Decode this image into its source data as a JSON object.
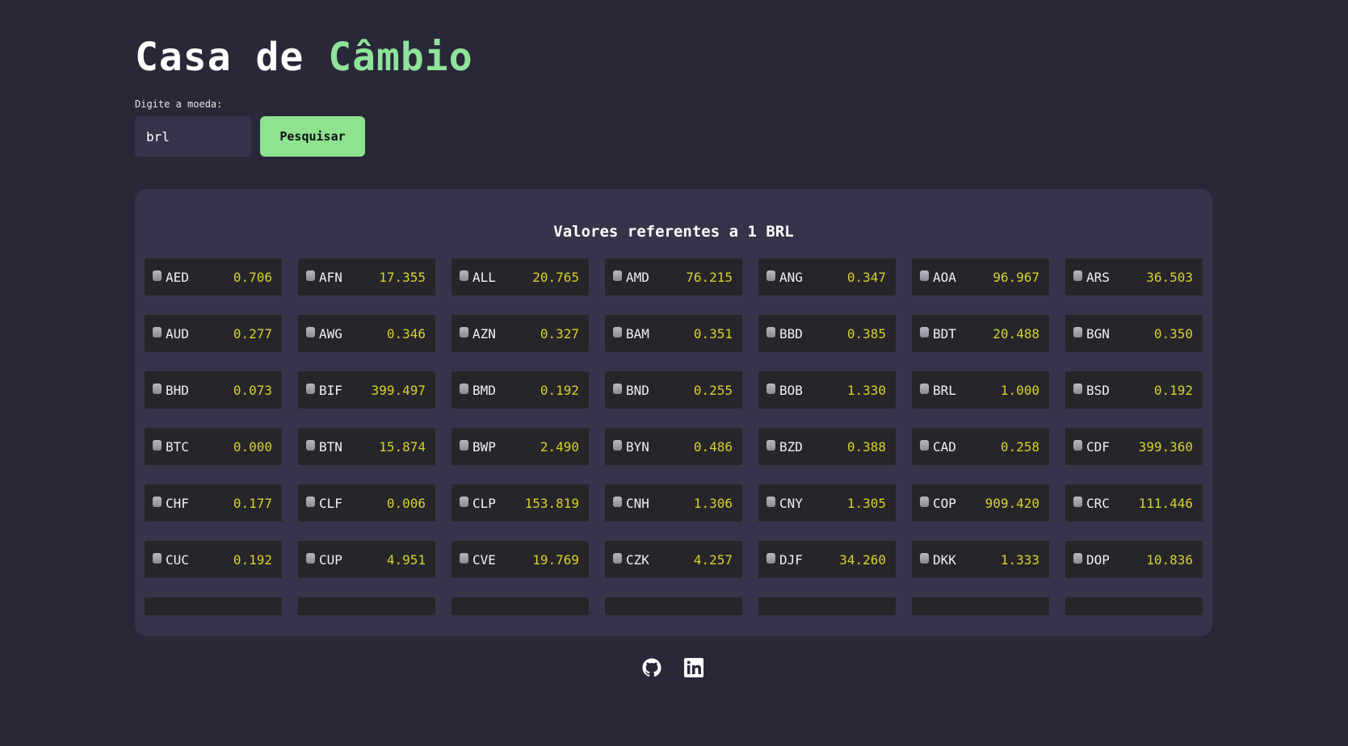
{
  "header": {
    "title_part1": "Casa de",
    "title_part2": "Câmbio"
  },
  "search": {
    "label": "Digite a moeda:",
    "value": "brl",
    "button_label": "Pesquisar"
  },
  "rates": {
    "title": "Valores referentes a 1 BRL",
    "icon": "coin-icon",
    "items": [
      {
        "code": "AED",
        "value": "0.706"
      },
      {
        "code": "AFN",
        "value": "17.355"
      },
      {
        "code": "ALL",
        "value": "20.765"
      },
      {
        "code": "AMD",
        "value": "76.215"
      },
      {
        "code": "ANG",
        "value": "0.347"
      },
      {
        "code": "AOA",
        "value": "96.967"
      },
      {
        "code": "ARS",
        "value": "36.503"
      },
      {
        "code": "AUD",
        "value": "0.277"
      },
      {
        "code": "AWG",
        "value": "0.346"
      },
      {
        "code": "AZN",
        "value": "0.327"
      },
      {
        "code": "BAM",
        "value": "0.351"
      },
      {
        "code": "BBD",
        "value": "0.385"
      },
      {
        "code": "BDT",
        "value": "20.488"
      },
      {
        "code": "BGN",
        "value": "0.350"
      },
      {
        "code": "BHD",
        "value": "0.073"
      },
      {
        "code": "BIF",
        "value": "399.497"
      },
      {
        "code": "BMD",
        "value": "0.192"
      },
      {
        "code": "BND",
        "value": "0.255"
      },
      {
        "code": "BOB",
        "value": "1.330"
      },
      {
        "code": "BRL",
        "value": "1.000"
      },
      {
        "code": "BSD",
        "value": "0.192"
      },
      {
        "code": "BTC",
        "value": "0.000"
      },
      {
        "code": "BTN",
        "value": "15.874"
      },
      {
        "code": "BWP",
        "value": "2.490"
      },
      {
        "code": "BYN",
        "value": "0.486"
      },
      {
        "code": "BZD",
        "value": "0.388"
      },
      {
        "code": "CAD",
        "value": "0.258"
      },
      {
        "code": "CDF",
        "value": "399.360"
      },
      {
        "code": "CHF",
        "value": "0.177"
      },
      {
        "code": "CLF",
        "value": "0.006"
      },
      {
        "code": "CLP",
        "value": "153.819"
      },
      {
        "code": "CNH",
        "value": "1.306"
      },
      {
        "code": "CNY",
        "value": "1.305"
      },
      {
        "code": "COP",
        "value": "909.420"
      },
      {
        "code": "CRC",
        "value": "111.446"
      },
      {
        "code": "CUC",
        "value": "0.192"
      },
      {
        "code": "CUP",
        "value": "4.951"
      },
      {
        "code": "CVE",
        "value": "19.769"
      },
      {
        "code": "CZK",
        "value": "4.257"
      },
      {
        "code": "DJF",
        "value": "34.260"
      },
      {
        "code": "DKK",
        "value": "1.333"
      },
      {
        "code": "DOP",
        "value": "10.836"
      }
    ]
  },
  "footer": {
    "links": [
      {
        "name": "github-icon"
      },
      {
        "name": "linkedin-icon"
      }
    ]
  }
}
